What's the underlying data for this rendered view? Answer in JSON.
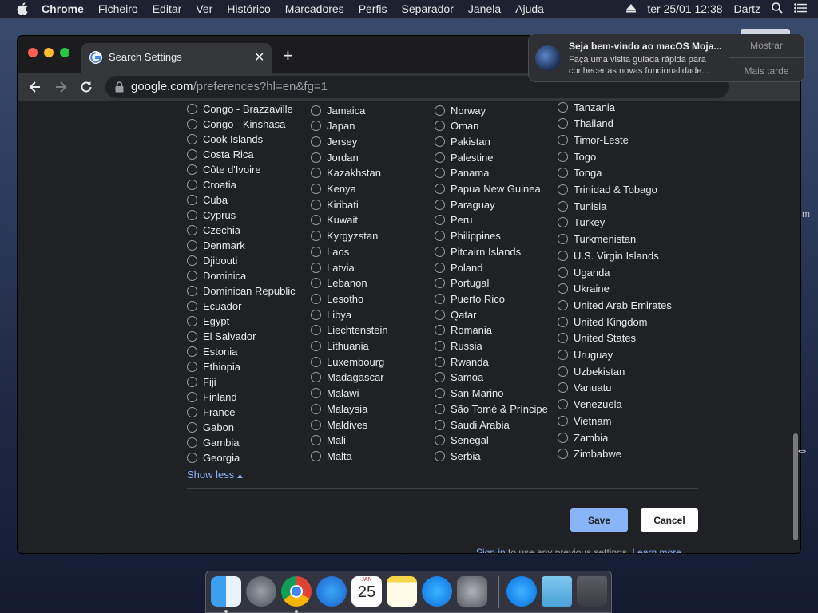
{
  "menubar": {
    "app": "Chrome",
    "items": [
      "Ficheiro",
      "Editar",
      "Ver",
      "Histórico",
      "Marcadores",
      "Perfis",
      "Separador",
      "Janela",
      "Ajuda"
    ],
    "datetime": "ter 25/01  12:38",
    "user": "Dartz"
  },
  "browser": {
    "tab_title": "Search Settings",
    "url_host": "google.com",
    "url_path": "/preferences?hl=en&fg=1"
  },
  "regions": {
    "col1": [
      "Congo - Brazzaville",
      "Congo - Kinshasa",
      "Cook Islands",
      "Costa Rica",
      "Côte d'Ivoire",
      "Croatia",
      "Cuba",
      "Cyprus",
      "Czechia",
      "Denmark",
      "Djibouti",
      "Dominica",
      "Dominican Republic",
      "Ecuador",
      "Egypt",
      "El Salvador",
      "Estonia",
      "Ethiopia",
      "Fiji",
      "Finland",
      "France",
      "Gabon",
      "Gambia",
      "Georgia"
    ],
    "col2": [
      "Jamaica",
      "Japan",
      "Jersey",
      "Jordan",
      "Kazakhstan",
      "Kenya",
      "Kiribati",
      "Kuwait",
      "Kyrgyzstan",
      "Laos",
      "Latvia",
      "Lebanon",
      "Lesotho",
      "Libya",
      "Liechtenstein",
      "Lithuania",
      "Luxembourg",
      "Madagascar",
      "Malawi",
      "Malaysia",
      "Maldives",
      "Mali",
      "Malta"
    ],
    "col3": [
      "Norway",
      "Oman",
      "Pakistan",
      "Palestine",
      "Panama",
      "Papua New Guinea",
      "Paraguay",
      "Peru",
      "Philippines",
      "Pitcairn Islands",
      "Poland",
      "Portugal",
      "Puerto Rico",
      "Qatar",
      "Romania",
      "Russia",
      "Rwanda",
      "Samoa",
      "San Marino",
      "São Tomé & Príncipe",
      "Saudi Arabia",
      "Senegal",
      "Serbia"
    ],
    "col4": [
      "Tanzania",
      "Thailand",
      "Timor-Leste",
      "Togo",
      "Tonga",
      "Trinidad & Tobago",
      "Tunisia",
      "Turkey",
      "Turkmenistan",
      "U.S. Virgin Islands",
      "Uganda",
      "Ukraine",
      "United Arab Emirates",
      "United Kingdom",
      "United States",
      "Uruguay",
      "Uzbekistan",
      "Vanuatu",
      "Venezuela",
      "Vietnam",
      "Zambia",
      "Zimbabwe"
    ]
  },
  "actions": {
    "show_less": "Show less",
    "save": "Save",
    "cancel": "Cancel",
    "signin_link": "Sign in",
    "signin_text": " to use any previous settings. ",
    "learn_more": "Learn more"
  },
  "notification": {
    "title": "Seja bem-vindo ao macOS Moja...",
    "body": "Faça uma visita guiada rápida para conhecer as novas funcionalidade...",
    "show_label": "Mostrar",
    "later_label": "Mais tarde"
  },
  "edge_text": "m",
  "dock": {
    "calendar_month": "JAN",
    "calendar_day": "25"
  },
  "colors": {
    "accent": "#8ab4f8",
    "page_bg": "#202124"
  }
}
